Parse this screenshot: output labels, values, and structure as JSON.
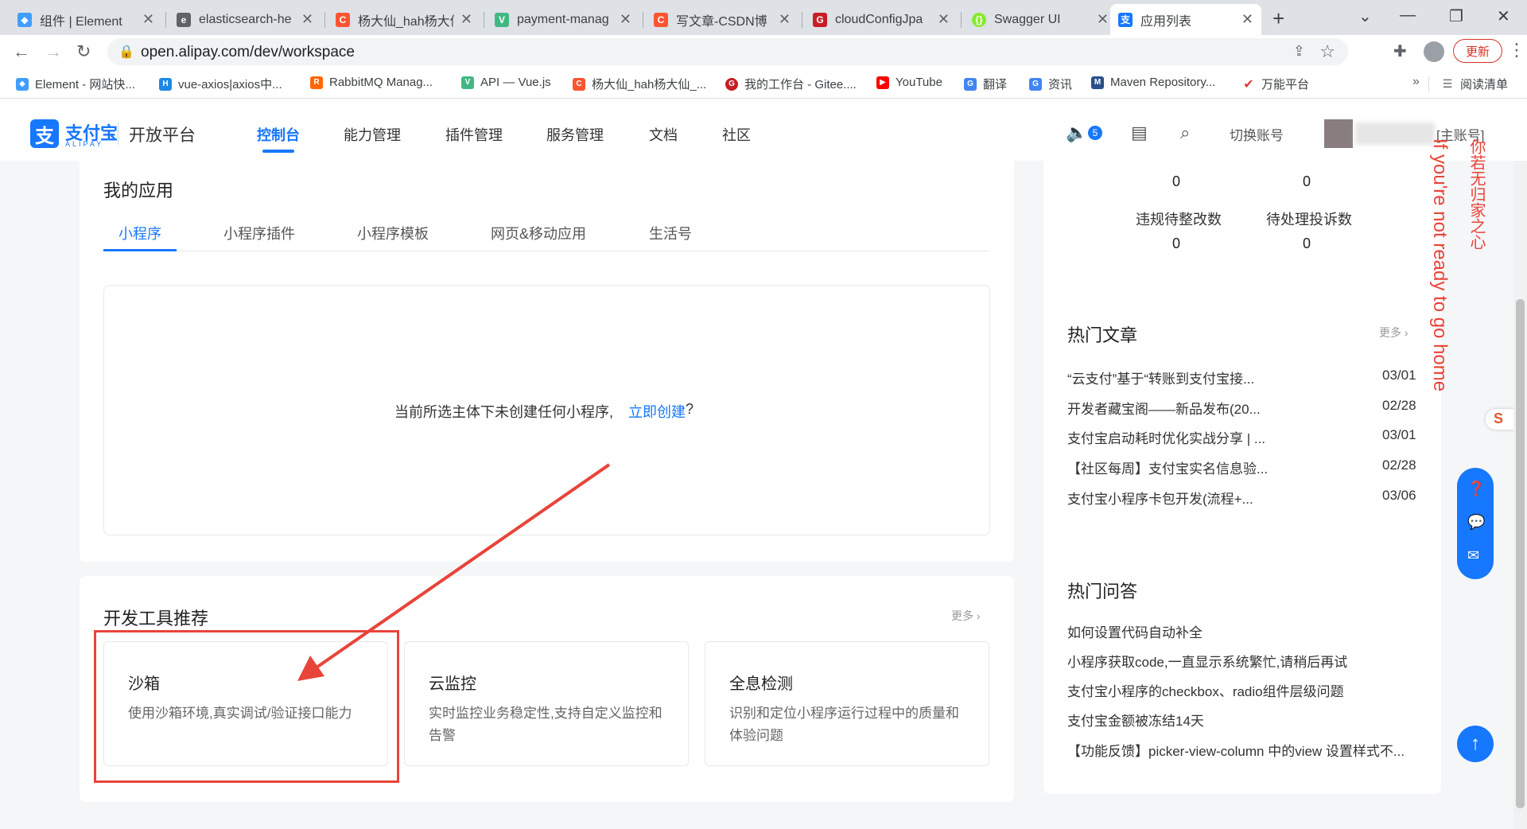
{
  "browser": {
    "tabs": [
      {
        "title": "组件 | Element",
        "favicon": "element-favicon",
        "color": "#409eff"
      },
      {
        "title": "elasticsearch-he",
        "favicon": "elasticsearch-favicon",
        "color": "#5f6368"
      },
      {
        "title": "杨大仙_hah杨大仙",
        "favicon": "csdn-favicon",
        "color": "#fc5531"
      },
      {
        "title": "payment-manag",
        "favicon": "vue-favicon",
        "color": "#41b883"
      },
      {
        "title": "写文章-CSDN博",
        "favicon": "csdn-favicon",
        "color": "#fc5531"
      },
      {
        "title": "cloudConfigJpa",
        "favicon": "gitee-favicon",
        "color": "#c71d23"
      },
      {
        "title": "Swagger UI",
        "favicon": "swagger-favicon",
        "color": "#85ea2d"
      },
      {
        "title": "应用列表",
        "favicon": "alipay-favicon",
        "color": "#1677ff"
      }
    ],
    "url": "open.alipay.com/dev/workspace",
    "update_label": "更新",
    "bookmarks": [
      {
        "label": "Element - 网站快...",
        "color": "#409eff"
      },
      {
        "label": "vue-axios|axios中...",
        "color": "#1e88e5"
      },
      {
        "label": "RabbitMQ Manag...",
        "color": "#f60"
      },
      {
        "label": "API — Vue.js",
        "color": "#41b883"
      },
      {
        "label": "杨大仙_hah杨大仙_...",
        "color": "#fc5531"
      },
      {
        "label": "我的工作台 - Gitee....",
        "color": "#c71d23"
      },
      {
        "label": "YouTube",
        "color": "#ff0000"
      },
      {
        "label": "翻译",
        "color": "#4285f4"
      },
      {
        "label": "资讯",
        "color": "#4285f4"
      },
      {
        "label": "Maven Repository...",
        "color": "#2a4f8a"
      },
      {
        "label": "万能平台",
        "color": "#e53935"
      }
    ],
    "reading_list": "阅读清单",
    "more_bookmarks": "»"
  },
  "header": {
    "logo_text": "支付宝",
    "logo_sub": "ALIPAY",
    "platform": "开放平台",
    "nav": [
      "控制台",
      "能力管理",
      "插件管理",
      "服务管理",
      "文档",
      "社区"
    ],
    "notify_count": "5",
    "switch_account": "切换账号",
    "main_account": "[主账号]"
  },
  "my_apps": {
    "title": "我的应用",
    "tabs": [
      "小程序",
      "小程序插件",
      "小程序模板",
      "网页&移动应用",
      "生活号"
    ],
    "empty_text": "当前所选主体下未创建任何小程序,",
    "create_link": "立即创建",
    "question_mark": "?"
  },
  "dev_tools": {
    "title": "开发工具推荐",
    "more": "更多",
    "tools": [
      {
        "name": "沙箱",
        "desc": "使用沙箱环境,真实调试/验证接口能力"
      },
      {
        "name": "云监控",
        "desc": "实时监控业务稳定性,支持自定义监控和告警"
      },
      {
        "name": "全息检测",
        "desc": "识别和定位小程序运行过程中的质量和体验问题"
      }
    ]
  },
  "stats": {
    "top_values": [
      "0",
      "0"
    ],
    "labels": [
      "违规待整改数",
      "待处理投诉数"
    ],
    "bottom_values": [
      "0",
      "0"
    ]
  },
  "hot_articles": {
    "title": "热门文章",
    "more": "更多",
    "items": [
      {
        "title": "“云支付”基于“转账到支付宝接...",
        "date": "03/01"
      },
      {
        "title": "开发者藏宝阁——新品发布(20...",
        "date": "02/28"
      },
      {
        "title": "支付宝启动耗时优化实战分享 | ...",
        "date": "03/01"
      },
      {
        "title": "【社区每周】支付宝实名信息验...",
        "date": "02/28"
      },
      {
        "title": "支付宝小程序卡包开发(流程+...",
        "date": "03/06"
      }
    ]
  },
  "hot_qa": {
    "title": "热门问答",
    "items": [
      "如何设置代码自动补全",
      "小程序获取code,一直显示系统繁忙,请稍后再试",
      "支付宝小程序的checkbox、radio组件层级问题",
      "支付宝金额被冻结14天",
      "【功能反馈】picker-view-column 中的view 设置样式不..."
    ]
  },
  "watermark": {
    "line1": "If you're not ready to go home",
    "line2": "你若无归家之心"
  },
  "colors": {
    "accent": "#1677ff",
    "annotation": "#e8443a"
  }
}
